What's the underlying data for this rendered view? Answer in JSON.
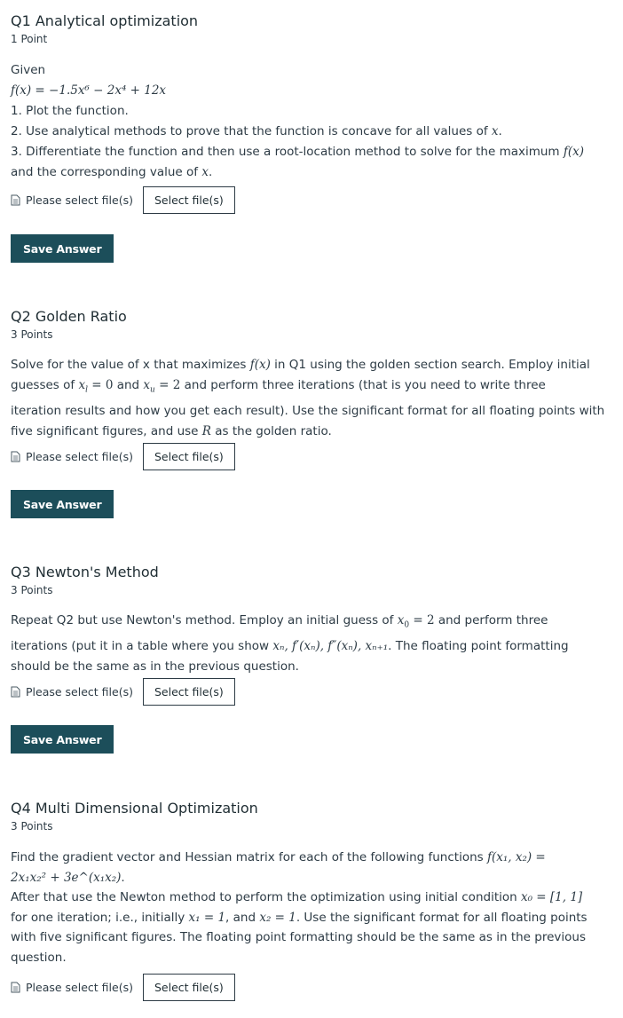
{
  "q1": {
    "title": "Q1 Analytical optimization",
    "points": "1 Point",
    "given": "Given",
    "func": "f(x) = −1.5x⁶ − 2x⁴ + 12x",
    "item1": "1. Plot the function.",
    "item2a": "2. Use analytical methods to prove that the function is concave for all values of ",
    "item2_var": "x",
    "item2b": ".",
    "item3a": "3. Differentiate the function and then use a root-location method to solve for the maximum ",
    "item3_fx": "f(x)",
    "item3b": "and the corresponding value of ",
    "item3_var": "x",
    "item3c": "."
  },
  "q2": {
    "title": "Q2 Golden Ratio",
    "points": "3 Points",
    "l1a": "Solve for the value of x that maximizes ",
    "l1_fx": "f(x)",
    "l1b": " in Q1 using the golden section search. Employ initial",
    "l2a": "guesses of ",
    "l2_xl": "x",
    "l2_xl_sub": "l",
    "l2_eq1": " = 0",
    "l2b": " and ",
    "l2_xu": "x",
    "l2_xu_sub": "u",
    "l2_eq2": " = 2",
    "l2c": " and perform three iterations (that is you need to write three",
    "l3": "iteration results and how you get each result). Use the significant format for all floating points with",
    "l4a": "five significant figures, and use ",
    "l4_R": "R",
    "l4b": " as the golden ratio."
  },
  "q3": {
    "title": "Q3 Newton's Method",
    "points": "3 Points",
    "l1a": "Repeat Q2  but use Newton's method. Employ an initial guess of ",
    "l1_x0": "x",
    "l1_sub0": "0",
    "l1_eq": " = 2",
    "l1b": " and perform three",
    "l2a": "iterations (put it in a table where you show ",
    "l2_math": "xₙ, f′(xₙ), f″(xₙ), xₙ₊₁",
    "l2b": ". The floating point formatting",
    "l3": "should be the same as in the previous question."
  },
  "q4": {
    "title": "Q4 Multi Dimensional Optimization",
    "points": "3 Points",
    "l1a": "Find the gradient vector and Hessian matrix for each of the following functions ",
    "l1_math": "f(x₁, x₂) =",
    "l2_math": "2x₁x₂² + 3e^(x₁x₂)",
    "l2_end": ".",
    "l3a": "After that use the Newton method to perform the optimization using initial condition ",
    "l3_math": "x₀ = [1, 1]",
    "l4a": "for one iteration; i.e., initially ",
    "l4_m1": "x₁ = 1",
    "l4b": ", and ",
    "l4_m2": "x₂ = 1",
    "l4c": ". Use the significant format for all floating points",
    "l5": "with five significant figures. The floating point formatting should be the same as in the previous",
    "l6": "question."
  },
  "upload": {
    "label": "Please select file(s)",
    "button": "Select file(s)"
  },
  "save_label": "Save Answer"
}
